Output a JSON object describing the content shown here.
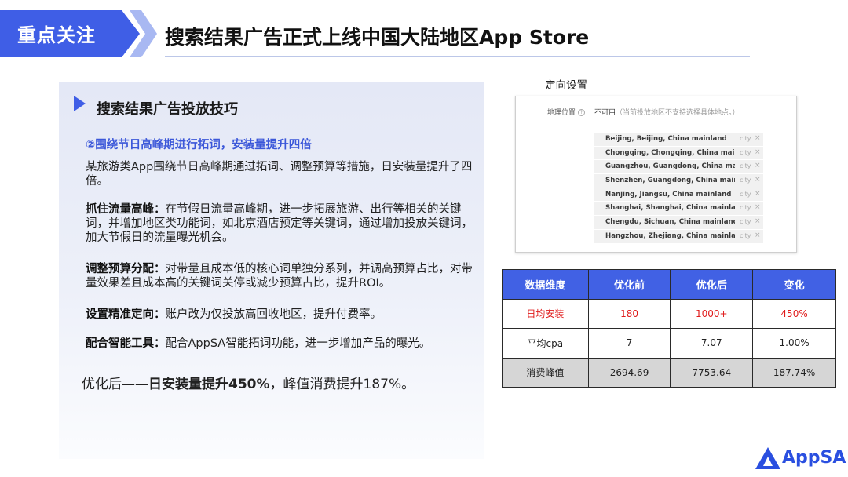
{
  "header": {
    "tag": "重点关注",
    "title": "搜索结果广告正式上线中国大陆地区App Store"
  },
  "panel": {
    "heading": "搜索结果广告投放技巧",
    "subheading": "②围绕节日高峰期进行拓词，安装量提升四倍",
    "intro": "某旅游类App围绕节日高峰期通过拓词、调整预算等措施，日安装量提升了四倍。",
    "tips": [
      {
        "title": "抓住流量高峰：",
        "body": "在节假日流量高峰期，进一步拓展旅游、出行等相关的关键词，并增加地区类功能词，如北京酒店预定等关键词，通过增加投放关键词，加大节假日的流量曝光机会。"
      },
      {
        "title": "调整预算分配：",
        "body": "对带量且成本低的核心词单独分系列，并调高预算占比，对带量效果差且成本高的关键词关停或减少预算占比，提升ROI。"
      },
      {
        "title": "设置精准定向：",
        "body": "账户改为仅投放高回收地区，提升付费率。"
      },
      {
        "title": "配合智能工具：",
        "body": "配合AppSA智能拓词功能，进一步增加产品的曝光。"
      }
    ],
    "final_prefix": "优化后——",
    "final_bold": "日安装量提升450%",
    "final_suffix": "，峰值消费提升187%。"
  },
  "targeting": {
    "label": "定向设置",
    "geo_label": "地理位置",
    "geo_help_icon": "question-circle-icon",
    "status": "不可用",
    "status_note": "（当前投放地区不支持选择具体地点。）",
    "tag": "city",
    "close_icon": "close-icon",
    "cities": [
      "Beijing, Beijing, China mainland",
      "Chongqing, Chongqing, China main...",
      "Guangzhou, Guangdong, China mai...",
      "Shenzhen, Guangdong, China main...",
      "Nanjing, Jiangsu, China mainland",
      "Shanghai, Shanghai, China mainland",
      "Chengdu, Sichuan, China mainland",
      "Hangzhou, Zhejiang, China mainland"
    ]
  },
  "table": {
    "headers": [
      "数据维度",
      "优化前",
      "优化后",
      "变化"
    ],
    "rows": [
      [
        "日均安装",
        "180",
        "1000+",
        "450%"
      ],
      [
        "平均cpa",
        "7",
        "7.07",
        "1.00%"
      ],
      [
        "消费峰值",
        "2694.69",
        "7753.64",
        "187.74%"
      ]
    ]
  },
  "logo": {
    "text": "AppSA",
    "icon": "appsa-triangle-logo-icon"
  },
  "colors": {
    "accent": "#3f5ee6",
    "table_header": "#4161e4",
    "highlight_red": "#e01b1b"
  }
}
